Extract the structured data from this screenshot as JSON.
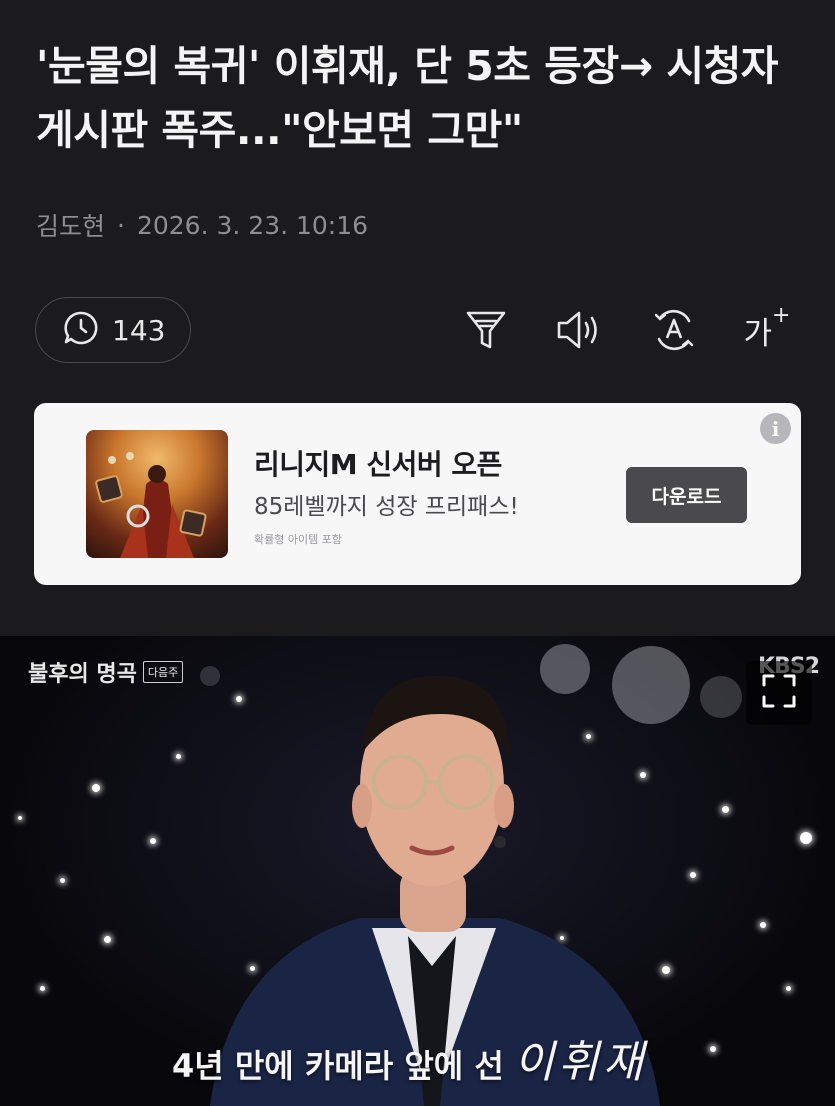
{
  "article": {
    "headline": "'눈물의 복귀' 이휘재, 단 5초 등장→ 시청자 게시판 폭주...\"안보면 그만\"",
    "author": "김도현",
    "separator": "·",
    "datetime": "2026. 3. 23. 10:16"
  },
  "toolbar": {
    "comment_count": "143",
    "icons": [
      "comment-clock-icon",
      "filter-icon",
      "speaker-icon",
      "translate-icon",
      "font-size-icon"
    ],
    "font_label": "가",
    "font_plus": "+"
  },
  "ad": {
    "title": "리니지M 신서버 오픈",
    "subtitle": "85레벨까지 성장 프리패스!",
    "fine_print": "확률형 아이템 포함",
    "cta": "다운로드",
    "info": "i"
  },
  "video": {
    "show_logo": "불후의 명곡",
    "show_tag": "다음주",
    "channel": "KBS2",
    "caption_text": "4년 만에 카메라 앞에 선",
    "caption_name": "이휘재"
  },
  "colors": {
    "background": "#1b1b1d",
    "ad_background": "#f7f7f7",
    "cta_button": "#4a4a4e"
  }
}
